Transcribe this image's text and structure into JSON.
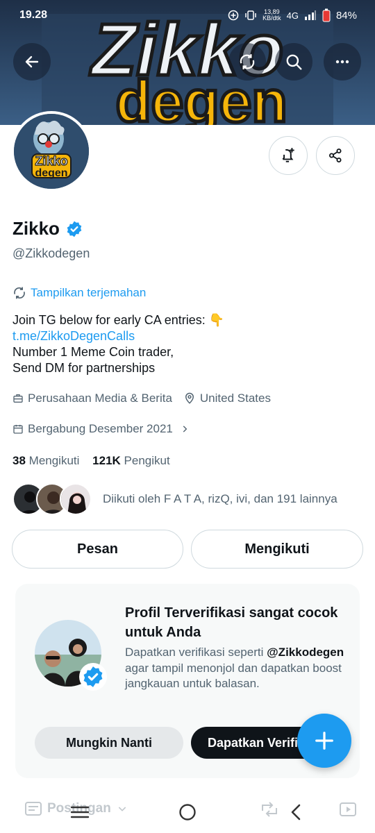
{
  "status": {
    "time": "19.28",
    "speed_top": "13,89",
    "speed_bottom": "KB/dtk",
    "network": "4G",
    "battery": "84%"
  },
  "banner": {
    "line1": "Zikko",
    "line2": "degen"
  },
  "avatar_logo": {
    "line1": "Zikko",
    "line2": "degen"
  },
  "profile": {
    "name": "Zikko",
    "handle": "@Zikkodegen",
    "verified": true,
    "translate_label": "Tampilkan terjemahan",
    "bio_line1": "Join TG below for early CA entries: 👇",
    "bio_link": "t.me/ZikkoDegenCalls",
    "bio_line3": "Number 1 Meme Coin trader,",
    "bio_line4": "Send DM for partnerships",
    "category": "Perusahaan Media & Berita",
    "location": "United States",
    "joined": "Bergabung Desember 2021",
    "following_count": "38",
    "following_label": "Mengikuti",
    "followers_count": "121K",
    "followers_label": "Pengikut",
    "followed_by": "Diikuti oleh F A T A, rizQ, ivi, dan 191 lainnya"
  },
  "actions": {
    "message": "Pesan",
    "following": "Mengikuti"
  },
  "promo": {
    "title": "Profil Terverifikasi sangat cocok untuk Anda",
    "desc_prefix": "Dapatkan verifikasi seperti",
    "desc_handle": "@Zikkodegen",
    "desc_suffix": "agar tampil menonjol dan dapatkan boost jangkauan untuk balasan.",
    "later_button": "Mungkin Nanti",
    "verify_button": "Dapatkan Verifikasi"
  },
  "tabs": {
    "posts": "Postingan"
  },
  "colors": {
    "accent": "#1d9bf0",
    "text": "#0f1419",
    "muted": "#536471",
    "border": "#cfd9de"
  },
  "icons": {
    "back": "arrow-left-icon",
    "translate": "translate-icon",
    "search": "search-icon",
    "more": "more-icon",
    "notify": "bell-plus-icon",
    "share": "share-icon",
    "compose": "plus-icon"
  }
}
